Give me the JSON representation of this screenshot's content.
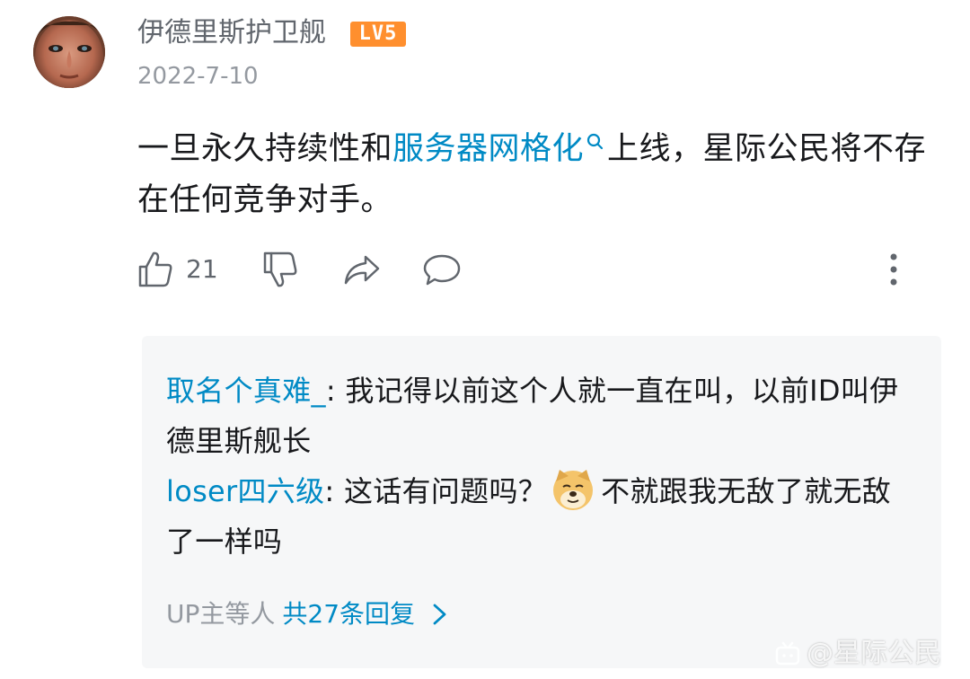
{
  "comment": {
    "author": "伊德里斯护卫舰",
    "level_badge": "LV5",
    "date": "2022-7-10",
    "text_before_link": "一旦永久持续性和",
    "link_text": "服务器网格化",
    "text_after_link": "上线，星际公民将不存在任何竞争对手。",
    "like_count": "21"
  },
  "replies": {
    "items": [
      {
        "user": "取名个真难_",
        "separator": ": ",
        "text": "我记得以前这个人就一直在叫，以前ID叫伊德里斯舰长"
      },
      {
        "user": "loser四六级",
        "separator": ": ",
        "text_before_emoji": "这话有问题吗？",
        "emoji": "doge-emoji",
        "text_after_emoji": "不就跟我无敌了就无敌了一样吗"
      }
    ],
    "footer_prefix": "UP主等人",
    "footer_count": "共27条回复"
  },
  "watermark": {
    "text": "@星际公民"
  },
  "colors": {
    "link": "#008ac5",
    "badge": "#ff8f2e",
    "muted": "#9499a0",
    "reply_bg": "#f6f7f8"
  },
  "icons": [
    "thumbs-up-icon",
    "thumbs-down-icon",
    "share-icon",
    "comment-icon",
    "more-vertical-icon",
    "search-icon",
    "chevron-right-icon",
    "doge-emoji",
    "bilibili-tv-icon"
  ]
}
